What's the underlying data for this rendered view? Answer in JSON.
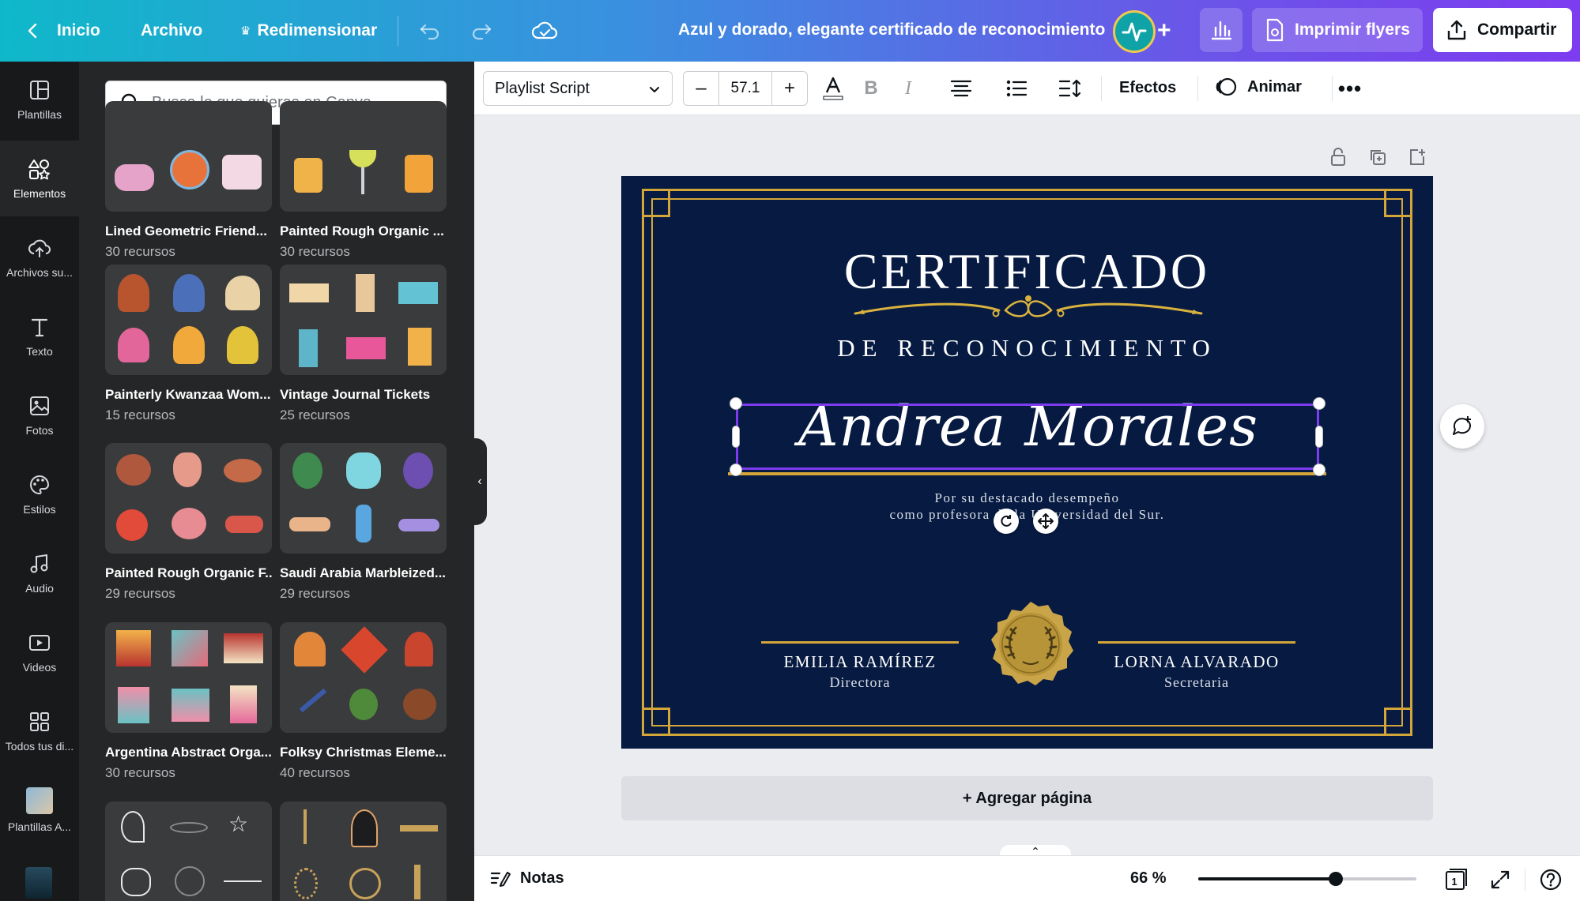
{
  "topbar": {
    "home_label": "Inicio",
    "file_label": "Archivo",
    "resize_label": "Redimensionar",
    "document_title": "Azul y dorado, elegante certificado de reconocimiento",
    "print_label": "Imprimir flyers",
    "share_label": "Compartir"
  },
  "rail": {
    "items": [
      {
        "label": "Plantillas",
        "icon": "layout-icon"
      },
      {
        "label": "Elementos",
        "icon": "shapes-icon"
      },
      {
        "label": "Archivos su...",
        "icon": "cloud-upload-icon"
      },
      {
        "label": "Texto",
        "icon": "text-icon"
      },
      {
        "label": "Fotos",
        "icon": "image-icon"
      },
      {
        "label": "Estilos",
        "icon": "palette-icon"
      },
      {
        "label": "Audio",
        "icon": "music-icon"
      },
      {
        "label": "Videos",
        "icon": "video-icon"
      },
      {
        "label": "Todos tus di...",
        "icon": "grid-icon"
      },
      {
        "label": "Plantillas A...",
        "icon": "thumbnail"
      }
    ]
  },
  "panel": {
    "search_placeholder": "Busca lo que quieras en Canva",
    "collections": [
      {
        "title": "Lined Geometric Friend...",
        "count": "30 recursos"
      },
      {
        "title": "Painted Rough Organic ...",
        "count": "30 recursos"
      },
      {
        "title": "Painterly Kwanzaa Wom...",
        "count": "15 recursos"
      },
      {
        "title": "Vintage Journal Tickets",
        "count": "25 recursos"
      },
      {
        "title": "Painted Rough Organic F...",
        "count": "29 recursos"
      },
      {
        "title": "Saudi Arabia Marbleized...",
        "count": "29 recursos"
      },
      {
        "title": "Argentina Abstract Orga...",
        "count": "30 recursos"
      },
      {
        "title": "Folksy Christmas Eleme...",
        "count": "40 recursos"
      }
    ]
  },
  "format_toolbar": {
    "font": "Playlist Script",
    "font_size": "57.1",
    "effects_label": "Efectos",
    "animate_label": "Animar"
  },
  "certificate": {
    "title": "CERTIFICADO",
    "subtitle": "DE RECONOCIMIENTO",
    "recipient": "Andrea Morales",
    "body_line1": "Por su destacado desempeño",
    "body_line2": "como profesora de la Universidad del Sur.",
    "signer_left_name": "EMILIA RAMÍREZ",
    "signer_left_role": "Directora",
    "signer_right_name": "LORNA ALVARADO",
    "signer_right_role": "Secretaria",
    "navy": "#061a42",
    "gold": "#d4a63a"
  },
  "canvas": {
    "add_page_label": "+ Agregar página"
  },
  "bottombar": {
    "notes_label": "Notas",
    "zoom_label": "66 %",
    "zoom_fraction": 0.63,
    "page_count": "1"
  }
}
